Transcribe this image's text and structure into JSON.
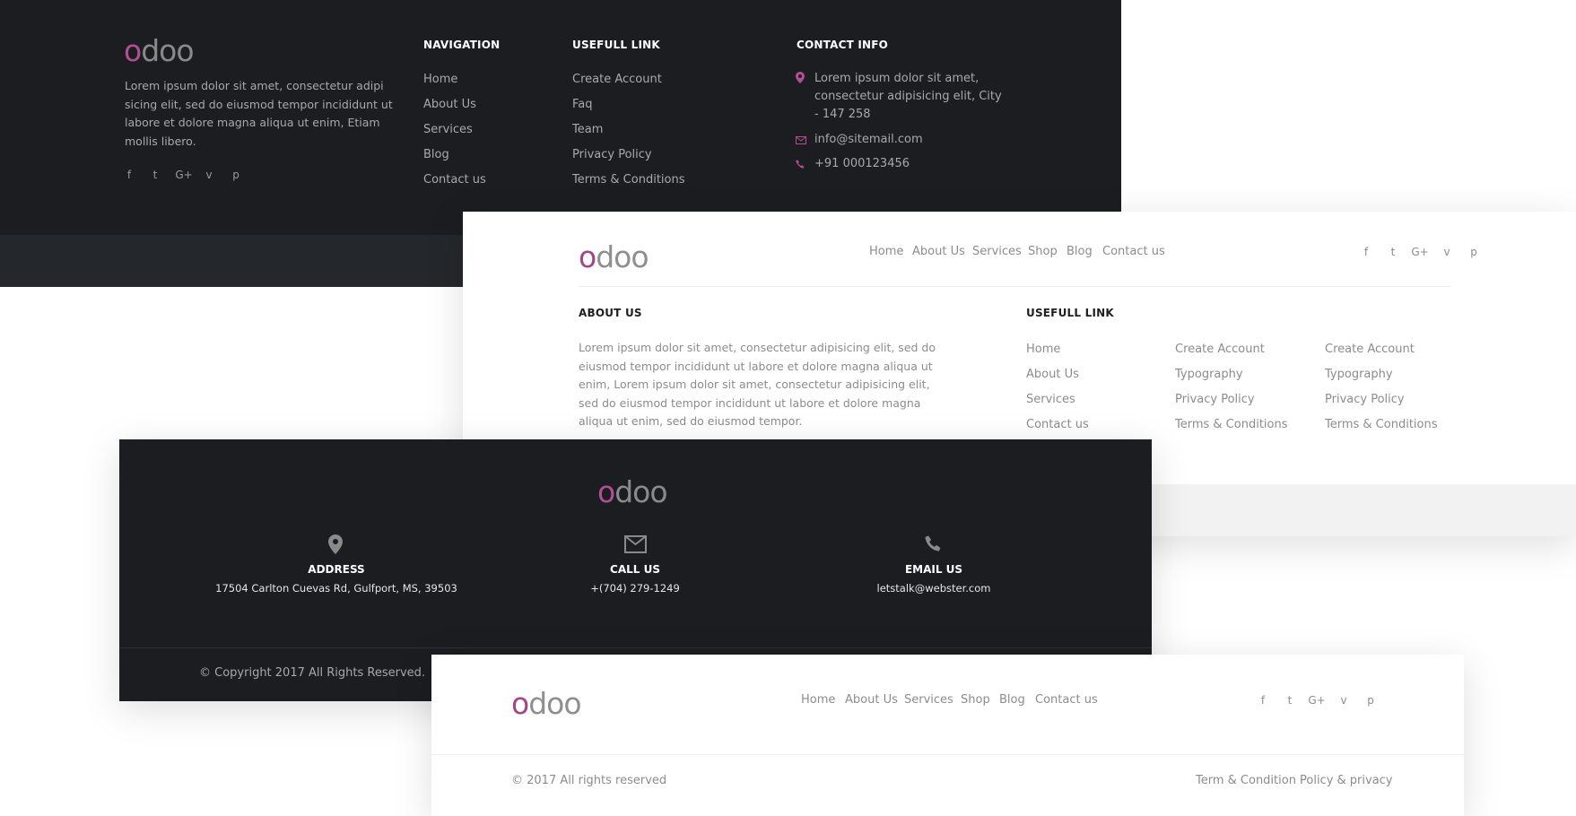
{
  "colors": {
    "accent": "#b24e95",
    "dark_bg": "#1b1d20",
    "dark_bar": "#24272b",
    "light_bar": "#f2f2f2"
  },
  "footer1": {
    "logo": "odoo",
    "about_text": "Lorem ipsum dolor sit amet, consectetur adipi sicing elit, sed do eiusmod tempor incididunt ut labore et dolore magna aliqua ut enim, Etiam mollis libero.",
    "social": [
      "facebook-icon",
      "twitter-icon",
      "google-plus-icon",
      "vimeo-icon",
      "pinterest-icon"
    ],
    "social_glyphs": [
      "f",
      "t",
      "G+",
      "v",
      "p"
    ],
    "navigation": {
      "title": "NAVIGATION",
      "items": [
        "Home",
        "About Us",
        "Services",
        "Blog",
        "Contact us"
      ]
    },
    "useful": {
      "title": "USEFULL LINK",
      "items": [
        "Create Account",
        "Faq",
        "Team",
        "Privacy Policy",
        "Terms & Conditions"
      ]
    },
    "contact": {
      "title": "CONTACT INFO",
      "address_l1": "Lorem ipsum dolor sit amet,",
      "address_l2": "consectetur adipisicing elit, City",
      "address_l3": "- 147 258",
      "email": "info@sitemail.com",
      "phone": "+91 000123456"
    }
  },
  "footer2": {
    "logo": "odoo",
    "nav": [
      "Home",
      "About Us",
      "Services",
      "Shop",
      "Blog",
      "Contact us"
    ],
    "social_glyphs": [
      "f",
      "t",
      "G+",
      "v",
      "p"
    ],
    "about": {
      "title": "ABOUT US",
      "text": "Lorem ipsum dolor sit amet, consectetur adipisicing elit, sed do eiusmod tempor incididunt ut labore et dolore magna aliqua ut enim, Lorem ipsum dolor sit amet, consectetur adipisicing elit, sed do eiusmod tempor incididunt ut labore et dolore magna aliqua ut enim, sed do eiusmod tempor."
    },
    "useful": {
      "title": "USEFULL LINK",
      "col1": [
        "Home",
        "About Us",
        "Services",
        "Contact us"
      ],
      "col2": [
        "Create Account",
        "Typography",
        "Privacy Policy",
        "Terms & Conditions"
      ],
      "col3": [
        "Create Account",
        "Typography",
        "Privacy Policy",
        "Terms & Conditions"
      ]
    }
  },
  "footer3": {
    "logo": "odoo",
    "address": {
      "title": "ADDRESS",
      "value": "17504 Carlton Cuevas Rd, Gulfport, MS, 39503"
    },
    "call": {
      "title": "CALL US",
      "value": "+(704) 279-1249"
    },
    "email": {
      "title": "EMAIL US",
      "value": "letstalk@webster.com"
    },
    "copyright": "© Copyright 2017 All Rights Reserved."
  },
  "footer4": {
    "logo": "odoo",
    "nav": [
      "Home",
      "About Us",
      "Services",
      "Shop",
      "Blog",
      "Contact us"
    ],
    "social_glyphs": [
      "f",
      "t",
      "G+",
      "v",
      "p"
    ],
    "copyright": "© 2017 All rights reserved",
    "legal": [
      "Term & Condition",
      "Policy & privacy"
    ]
  }
}
